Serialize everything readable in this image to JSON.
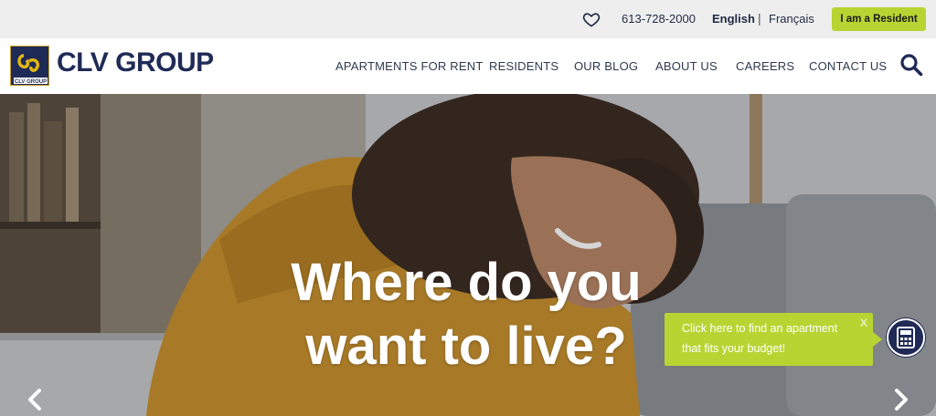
{
  "topbar": {
    "favorites_icon": "heart-icon",
    "phone": "613-728-2000",
    "lang_english": "English",
    "lang_separator": "|",
    "lang_french": "Français",
    "resident_button": "I am a Resident"
  },
  "header": {
    "logo_text": "CLV GROUP",
    "logo_badge_text": "CLV GROUP",
    "nav": [
      {
        "label": "APARTMENTS FOR RENT"
      },
      {
        "label": "RESIDENTS"
      },
      {
        "label": "OUR BLOG"
      },
      {
        "label": "ABOUT US"
      },
      {
        "label": "CAREERS"
      },
      {
        "label": "CONTACT US"
      }
    ],
    "search_icon": "search-icon"
  },
  "hero": {
    "title_line1": "Where do you",
    "title_line2": "want to live?",
    "prev_icon": "chevron-left-icon",
    "next_icon": "chevron-right-icon"
  },
  "budget_popup": {
    "text": "Click here to find an apartment that fits your budget!",
    "close_label": "X",
    "calculator_icon": "calculator-icon"
  },
  "colors": {
    "brand_navy": "#1f2a56",
    "accent_green": "#b8d433",
    "topbar_bg": "#eeeeee"
  }
}
